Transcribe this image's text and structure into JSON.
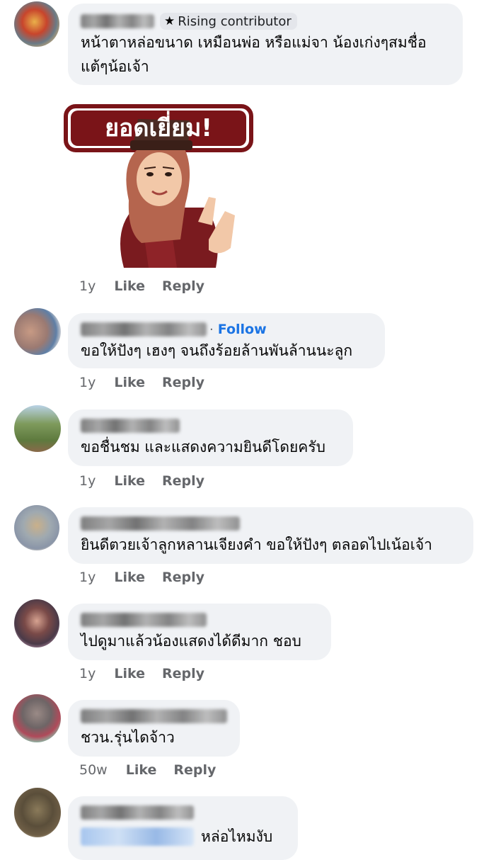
{
  "comments": [
    {
      "badge": "Rising contributor",
      "badge_icon": "star-icon",
      "text_lines": [
        "หน้าตาหล่อขนาด เหมือนพ่อ หรือแม่จา น้องเก่งๆสมชื่อ",
        "แต้ๆน้อเจ้า"
      ],
      "sticker_text": "ยอดเยี่ยม!",
      "time": "1y",
      "like": "Like",
      "reply": "Reply"
    },
    {
      "follow": "Follow",
      "follow_sep": "·",
      "text": "ขอให้ปังๆ เฮงๆ จนถึงร้อยล้านพันล้านนะลูก",
      "time": "1y",
      "like": "Like",
      "reply": "Reply"
    },
    {
      "text": "ขอชื่นชม และแสดงความยินดีโดยครับ",
      "time": "1y",
      "like": "Like",
      "reply": "Reply"
    },
    {
      "text": "ยินดีตวยเจ้าลูกหลานเจียงคำ ขอให้ปังๆ ตลอดไปเน้อเจ้า",
      "time": "1y",
      "like": "Like",
      "reply": "Reply"
    },
    {
      "text": "ไปดูมาแล้วน้องแสดงได้ดีมาก ชอบ",
      "time": "1y",
      "like": "Like",
      "reply": "Reply"
    },
    {
      "text": "ชวน.รุ่นไดจ้าว",
      "time": "50w",
      "like": "Like",
      "reply": "Reply"
    },
    {
      "text": "หล่อไหมงับ"
    }
  ],
  "colors": {
    "bubble": "#f0f2f5",
    "meta": "#65676b",
    "follow": "#1b74e4",
    "sticker_red": "#7a1418"
  }
}
